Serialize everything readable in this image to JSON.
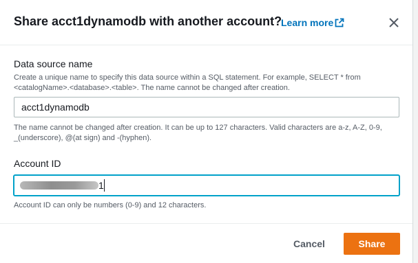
{
  "modal": {
    "title": "Share acct1dynamodb with another account?",
    "learn_more": "Learn more",
    "icons": {
      "external_link": "external-link-icon",
      "close": "close-icon"
    }
  },
  "data_source": {
    "label": "Data source name",
    "description": "Create a unique name to specify this data source within a SQL statement. For example, SELECT * from <catalogName>.<database>.<table>. The name cannot be changed after creation.",
    "value": "acct1dynamodb",
    "hint": "The name cannot be changed after creation. It can be up to 127 characters. Valid characters are a-z, A-Z, 0-9, _(underscore), @(at sign) and -(hyphen)."
  },
  "account_id": {
    "label": "Account ID",
    "visible_value_suffix": "1",
    "hint": "Account ID can only be numbers (0-9) and 12 characters."
  },
  "footer": {
    "cancel_label": "Cancel",
    "share_label": "Share"
  },
  "colors": {
    "primary_button": "#ec7211",
    "link": "#0073bb",
    "focus_border": "#00a1c9"
  }
}
